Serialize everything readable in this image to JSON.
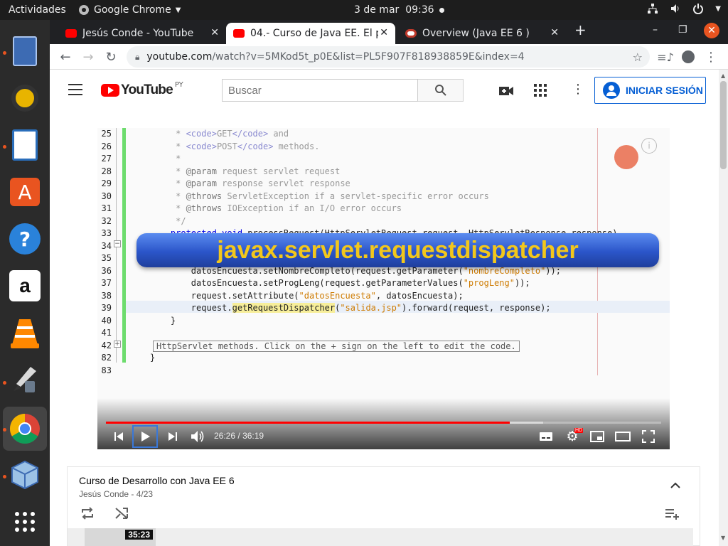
{
  "topbar": {
    "activities": "Actividades",
    "app_name": "Google Chrome",
    "date": "3 de mar",
    "time": "09:36"
  },
  "dock": {
    "items": [
      {
        "name": "files-icon",
        "color": "#3d6bb3"
      },
      {
        "name": "rhythmbox-icon",
        "color": "#e8b400"
      },
      {
        "name": "libreoffice-writer-icon",
        "color": "#2a6ebb"
      },
      {
        "name": "software-center-icon",
        "color": "#e95420"
      },
      {
        "name": "help-icon",
        "color": "#2a82da"
      },
      {
        "name": "amazon-icon",
        "color": "#ffffff"
      },
      {
        "name": "vlc-icon",
        "color": "#ff8800"
      },
      {
        "name": "gimp-brush-icon",
        "color": "#6a7a8c"
      },
      {
        "name": "chrome-icon",
        "color": "#4285f4"
      },
      {
        "name": "virtualbox-icon",
        "color": "#9cc2e6"
      },
      {
        "name": "show-apps-icon",
        "color": "#ffffff"
      }
    ]
  },
  "tabs": [
    {
      "title": "Jesús Conde - YouTube",
      "active": false
    },
    {
      "title": "04.- Curso de Java EE. El p",
      "active": true
    },
    {
      "title": "Overview (Java EE 6 )",
      "active": false
    }
  ],
  "new_tab": "+",
  "address": {
    "host": "youtube.com",
    "path": "/watch?v=5MKod5t_p0E&list=PL5F907F818938859E&index=4"
  },
  "youtube": {
    "logo_text": "YouTube",
    "region": "PY",
    "search_placeholder": "Buscar",
    "signin_label": "INICIAR SESIÓN"
  },
  "video": {
    "overlay_title": "javax.servlet.requestdispatcher",
    "current_time": "26:26",
    "duration": "36:19",
    "time_separator": "/",
    "progress": 0.7276,
    "buffered": 0.787,
    "code_lines": [
      {
        "n": "25",
        "t": "     * <code>GET</code> and"
      },
      {
        "n": "26",
        "t": "     * <code>POST</code> methods."
      },
      {
        "n": "27",
        "t": "     *"
      },
      {
        "n": "28",
        "t": "     * @param request servlet request"
      },
      {
        "n": "29",
        "t": "     * @param response servlet response"
      },
      {
        "n": "30",
        "t": "     * @throws ServletException if a servlet-specific error occurs"
      },
      {
        "n": "31",
        "t": "     * @throws IOException if an I/O error occurs"
      },
      {
        "n": "32",
        "t": "     */"
      },
      {
        "n": "33",
        "t": "    protected void processRequest(HttpServletRequest request, HttpServletResponse response)"
      },
      {
        "n": "34",
        "t": ""
      },
      {
        "n": "35",
        "t": ""
      },
      {
        "n": "36",
        "t": "        datosEncuesta.setNombreCompleto(request.getParameter(\"nombreCompleto\"));"
      },
      {
        "n": "37",
        "t": "        datosEncuesta.setProgLeng(request.getParameterValues(\"progLeng\"));"
      },
      {
        "n": "38",
        "t": "        request.setAttribute(\"datosEncuesta\", datosEncuesta);"
      },
      {
        "n": "39",
        "t": "        request.getRequestDispatcher(\"salida.jsp\").forward(request, response);"
      },
      {
        "n": "40",
        "t": "    }"
      },
      {
        "n": "41",
        "t": ""
      },
      {
        "n": "42",
        "t": "    HttpServlet methods. Click on the + sign on the left to edit the code."
      },
      {
        "n": "82",
        "t": "}"
      },
      {
        "n": "83",
        "t": ""
      }
    ]
  },
  "playlist": {
    "title": "Curso de Desarrollo con Java EE 6",
    "subtitle": "Jesús Conde - 4/23",
    "thumb_duration": "35:23"
  }
}
